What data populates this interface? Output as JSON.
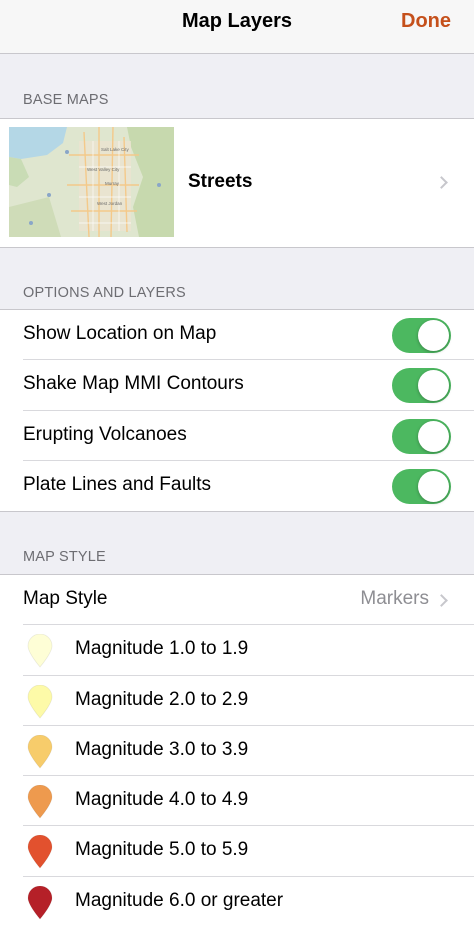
{
  "nav": {
    "title": "Map Layers",
    "done_label": "Done"
  },
  "base_maps": {
    "header": "BASE MAPS",
    "selected_label": "Streets",
    "thumbnail_labels": [
      "Salt Lake City",
      "West Valley City",
      "Murray",
      "West Jordan"
    ]
  },
  "options": {
    "header": "OPTIONS AND LAYERS",
    "items": [
      {
        "label": "Show Location on Map",
        "on": true
      },
      {
        "label": "Shake Map MMI Contours",
        "on": true
      },
      {
        "label": "Erupting Volcanoes",
        "on": true
      },
      {
        "label": "Plate Lines and Faults",
        "on": true
      }
    ]
  },
  "map_style": {
    "header": "MAP STYLE",
    "label": "Map Style",
    "value": "Markers",
    "legend": [
      {
        "label": "Magnitude 1.0 to 1.9",
        "color": "#fefed6"
      },
      {
        "label": "Magnitude 2.0 to 2.9",
        "color": "#fdfaa8"
      },
      {
        "label": "Magnitude 3.0 to 3.9",
        "color": "#f7cc6b"
      },
      {
        "label": "Magnitude 4.0 to 4.9",
        "color": "#ee9a4e"
      },
      {
        "label": "Magnitude 5.0 to 5.9",
        "color": "#e2512e"
      },
      {
        "label": "Magnitude 6.0 or greater",
        "color": "#b52028"
      }
    ]
  }
}
